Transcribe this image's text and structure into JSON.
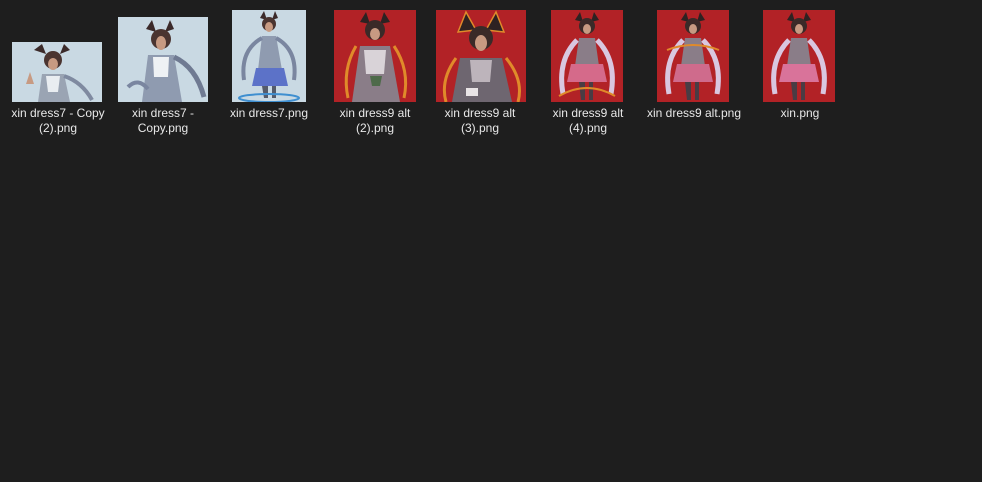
{
  "files": [
    {
      "name": "xin dress7 - Copy (2).png",
      "line1": "xin dress7 - Copy",
      "line2": "(2).png",
      "theme": "blue"
    },
    {
      "name": "xin dress7 - Copy.png",
      "line1": "xin dress7 -",
      "line2": "Copy.png",
      "theme": "blue"
    },
    {
      "name": "xin dress7.png",
      "line1": "xin dress7.png",
      "line2": "",
      "theme": "blue"
    },
    {
      "name": "xin dress9 alt (2).png",
      "line1": "xin dress9 alt",
      "line2": "(2).png",
      "theme": "red"
    },
    {
      "name": "xin dress9 alt (3).png",
      "line1": "xin dress9 alt",
      "line2": "(3).png",
      "theme": "red"
    },
    {
      "name": "xin dress9 alt (4).png",
      "line1": "xin dress9 alt",
      "line2": "(4).png",
      "theme": "red"
    },
    {
      "name": "xin dress9 alt.png",
      "line1": "xin dress9 alt.png",
      "line2": "",
      "theme": "red"
    },
    {
      "name": "xin.png",
      "line1": "xin.png",
      "line2": "",
      "theme": "red"
    }
  ],
  "colors": {
    "background": "#1e1e1e",
    "label_text": "#e8e8e8",
    "blue_thumb_bg": "#c9d9e3",
    "red_thumb_bg": "#b22226"
  }
}
